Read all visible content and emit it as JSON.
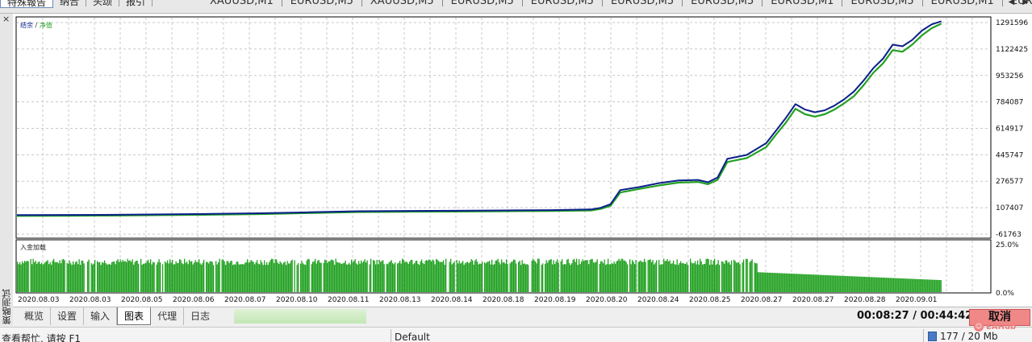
{
  "top_left_tabs": [
    "特殊報告",
    "纳合",
    "头颂",
    "报引"
  ],
  "symbol_tabs": [
    "XAUUSD,M1",
    "EURUSD,M5",
    "XAUUSD,M5",
    "EURUSD,M5",
    "EURUSD,M5",
    "EURUSD,M5",
    "EURUSD,M5",
    "EURUSD,M1",
    "EURUSD,M5",
    "EURUSD,M1",
    "EURU"
  ],
  "sidebar": {
    "close_glyph": "×",
    "vertical_label": "策略测试"
  },
  "chart_data": [
    {
      "type": "line",
      "legend": {
        "balance_label": "结余",
        "separator": " / ",
        "equity_label": "净值"
      },
      "y_ticks": [
        1291596,
        1122425,
        953256,
        784087,
        614917,
        445747,
        276577,
        107407,
        -61763
      ],
      "ylim": [
        -61763,
        1291596
      ],
      "x_tick_labels": [
        "2020.08.03",
        "2020.08.03",
        "2020.08.05",
        "2020.08.06",
        "2020.08.07",
        "2020.08.10",
        "2020.08.11",
        "2020.08.13",
        "2020.08.14",
        "2020.08.18",
        "2020.08.19",
        "2020.08.20",
        "2020.08.24",
        "2020.08.25",
        "2020.08.27",
        "2020.08.27",
        "2020.08.28",
        "2020.09.01"
      ],
      "series": [
        {
          "key": "balance",
          "color": "#0b1f8a",
          "points": [
            [
              0,
              60000
            ],
            [
              5,
              61000
            ],
            [
              10,
              62000
            ],
            [
              15,
              65000
            ],
            [
              20,
              68000
            ],
            [
              25,
              72000
            ],
            [
              30,
              78000
            ],
            [
              35,
              85000
            ],
            [
              40,
              87000
            ],
            [
              45,
              88000
            ],
            [
              50,
              90000
            ],
            [
              55,
              92000
            ],
            [
              59,
              96000
            ],
            [
              60,
              107000
            ],
            [
              61,
              130000
            ],
            [
              62,
              220000
            ],
            [
              64,
              240000
            ],
            [
              66,
              265000
            ],
            [
              68,
              282000
            ],
            [
              70,
              285000
            ],
            [
              71,
              270000
            ],
            [
              72,
              300000
            ],
            [
              73,
              420000
            ],
            [
              75,
              445000
            ],
            [
              77,
              520000
            ],
            [
              78,
              600000
            ],
            [
              79,
              680000
            ],
            [
              80,
              770000
            ],
            [
              81,
              735000
            ],
            [
              82,
              718000
            ],
            [
              83,
              730000
            ],
            [
              84,
              760000
            ],
            [
              85,
              800000
            ],
            [
              86,
              850000
            ],
            [
              87,
              920000
            ],
            [
              88,
              1000000
            ],
            [
              89,
              1060000
            ],
            [
              90,
              1150000
            ],
            [
              91,
              1140000
            ],
            [
              92,
              1180000
            ],
            [
              93,
              1240000
            ],
            [
              94,
              1280000
            ],
            [
              95,
              1300000
            ]
          ]
        },
        {
          "key": "equity",
          "color": "#22a022",
          "points": [
            [
              0,
              55000
            ],
            [
              5,
              56000
            ],
            [
              10,
              57000
            ],
            [
              15,
              60000
            ],
            [
              20,
              63000
            ],
            [
              25,
              67000
            ],
            [
              30,
              73000
            ],
            [
              35,
              80000
            ],
            [
              40,
              82000
            ],
            [
              45,
              83000
            ],
            [
              50,
              85000
            ],
            [
              55,
              87000
            ],
            [
              59,
              90000
            ],
            [
              60,
              100000
            ],
            [
              61,
              120000
            ],
            [
              62,
              205000
            ],
            [
              64,
              228000
            ],
            [
              66,
              250000
            ],
            [
              68,
              268000
            ],
            [
              70,
              272000
            ],
            [
              71,
              258000
            ],
            [
              72,
              285000
            ],
            [
              73,
              400000
            ],
            [
              75,
              425000
            ],
            [
              77,
              495000
            ],
            [
              78,
              575000
            ],
            [
              79,
              650000
            ],
            [
              80,
              740000
            ],
            [
              81,
              705000
            ],
            [
              82,
              690000
            ],
            [
              83,
              705000
            ],
            [
              84,
              735000
            ],
            [
              85,
              775000
            ],
            [
              86,
              820000
            ],
            [
              87,
              890000
            ],
            [
              88,
              970000
            ],
            [
              89,
              1030000
            ],
            [
              90,
              1115000
            ],
            [
              91,
              1105000
            ],
            [
              92,
              1150000
            ],
            [
              93,
              1210000
            ],
            [
              94,
              1255000
            ],
            [
              95,
              1285000
            ]
          ]
        }
      ]
    },
    {
      "type": "bar",
      "title": "入金加载",
      "y_ticks": [
        "25.0%",
        "0.0%"
      ],
      "ylim": [
        0,
        25
      ],
      "color": "#1fa01f",
      "segments": [
        {
          "from_index": 0,
          "to_index": 76,
          "value": 16
        },
        {
          "from_index": 76,
          "to_index": 95,
          "value_start": 10,
          "value_end": 6
        }
      ]
    }
  ],
  "bottom_tabs": [
    "概览",
    "设置",
    "输入",
    "图表",
    "代理",
    "日志"
  ],
  "active_tab_index": 3,
  "timer": {
    "elapsed": "00:08:27",
    "separator": " / ",
    "total": "00:44:42"
  },
  "cancel_label": "取消",
  "status": {
    "help": "查看帮忙, 请按 F1",
    "profile": "Default",
    "traffic": "177 / 20 Mb"
  },
  "watermark": "EAHub"
}
